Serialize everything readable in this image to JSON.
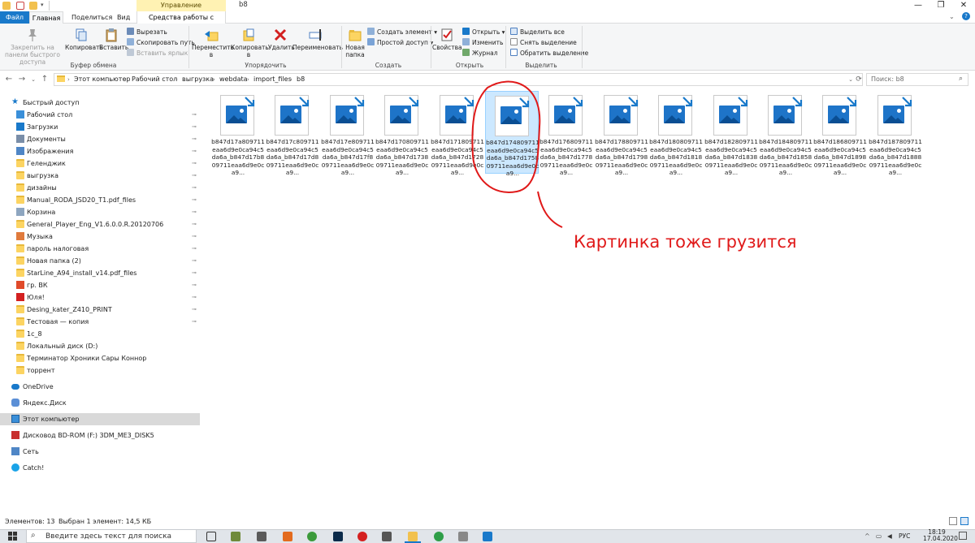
{
  "window": {
    "title": "b8",
    "manage_label": "Управление",
    "tools_label": "Средства работы с рисунками"
  },
  "tabs": {
    "file": "Файл",
    "home": "Главная",
    "share": "Поделиться",
    "view": "Вид"
  },
  "ribbon": {
    "clipboard": {
      "label": "Буфер обмена",
      "pin": "Закрепить на панели быстрого доступа",
      "copy": "Копировать",
      "paste": "Вставить",
      "cut": "Вырезать",
      "copy_path": "Скопировать путь",
      "paste_shortcut": "Вставить ярлык"
    },
    "organize": {
      "label": "Упорядочить",
      "move": "Переместить в",
      "copy_to": "Копировать в",
      "delete": "Удалить",
      "rename": "Переименовать"
    },
    "create": {
      "label": "Создать",
      "new_folder": "Новая папка",
      "new_item": "Создать элемент",
      "easy_access": "Простой доступ"
    },
    "open": {
      "label": "Открыть",
      "properties": "Свойства",
      "open": "Открыть",
      "edit": "Изменить",
      "history": "Журнал"
    },
    "select": {
      "label": "Выделить",
      "select_all": "Выделить все",
      "select_none": "Снять выделение",
      "invert": "Обратить выделение"
    }
  },
  "address": {
    "crumbs": [
      "Этот компьютер",
      "Рабочий стол",
      "выгрузка",
      "webdata",
      "import_files",
      "b8"
    ],
    "search_placeholder": "Поиск: b8"
  },
  "nav": {
    "quick_access": "Быстрый доступ",
    "items": [
      "Рабочий стол",
      "Загрузки",
      "Документы",
      "Изображения",
      "Геленджик",
      "выгрузка",
      "дизайны",
      "Manual_RODA_JSD20_T1.pdf_files",
      "Корзина",
      "General_Player_Eng_V1.6.0.0.R.20120706",
      "Музыка",
      "пароль налоговая",
      "Новая папка (2)",
      "StarLine_A94_install_v14.pdf_files",
      "гр. ВК",
      "Юля!",
      "Desing_kater_Z410_PRINT",
      "Тестовая — копия",
      "1с_8",
      "Локальный диск (D:)",
      "Терминатор Хроники Сары Коннор",
      "торрент"
    ],
    "onedrive": "OneDrive",
    "yandex": "Яндекс.Диск",
    "this_pc": "Этот компьютер",
    "bdrom": "Дисковод BD-ROM (F:) 3DM_ME3_DISK5",
    "network": "Сеть",
    "catch": "Catch!"
  },
  "files": [
    "b847d17a809711eaa6d9e0ca94c5da6a_b847d17b809711eaa6d9e0ca9...",
    "b847d17c809711eaa6d9e0ca94c5da6a_b847d17d809711eaa6d9e0ca9...",
    "b847d17e809711eaa6d9e0ca94c5da6a_b847d17f809711eaa6d9e0ca9...",
    "b847d170809711eaa6d9e0ca94c5da6a_b847d173809711eaa6d9e0ca9...",
    "b847d171809711eaa6d9e0ca94c5da6a_b847d172809711eaa6d9e0ca9...",
    "b847d174809711eaa6d9e0ca94c5da6a_b847d175809711eaa6d9e0ca9...",
    "b847d176809711eaa6d9e0ca94c5da6a_b847d177809711eaa6d9e0ca9...",
    "b847d178809711eaa6d9e0ca94c5da6a_b847d179809711eaa6d9e0ca9...",
    "b847d180809711eaa6d9e0ca94c5da6a_b847d181809711eaa6d9e0ca9...",
    "b847d182809711eaa6d9e0ca94c5da6a_b847d183809711eaa6d9e0ca9...",
    "b847d184809711eaa6d9e0ca94c5da6a_b847d185809711eaa6d9e0ca9...",
    "b847d186809711eaa6d9e0ca94c5da6a_b847d189809711eaa6d9e0ca9...",
    "b847d187809711eaa6d9e0ca94c5da6a_b847d188809711eaa6d9e0ca9..."
  ],
  "selected_file_index": 5,
  "annotation": {
    "text": "Картинка тоже грузится",
    "color": "#e01919"
  },
  "status": {
    "count": "Элементов: 13",
    "selected": "Выбран 1 элемент: 14,5 КБ"
  },
  "taskbar": {
    "search": "Введите здесь текст для поиска",
    "lang": "РУС",
    "time": "18:19",
    "date": "17.04.2020"
  },
  "colors": {
    "accent": "#1979ca",
    "selection": "#cce8ff",
    "folder": "#fcd462"
  }
}
